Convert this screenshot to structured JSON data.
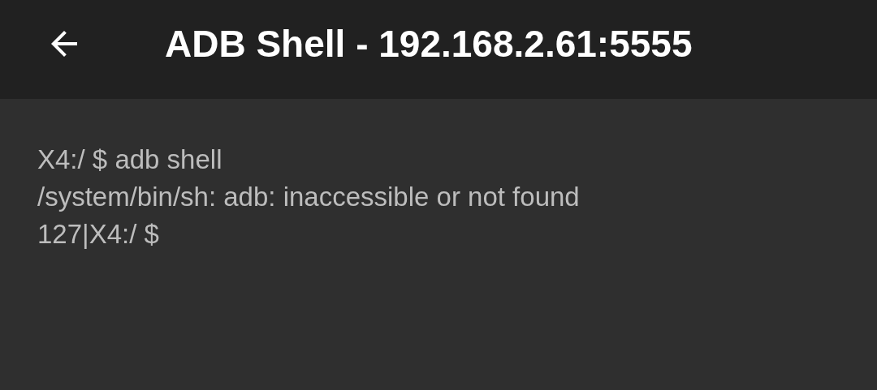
{
  "app_bar": {
    "title": "ADB Shell - 192.168.2.61:5555"
  },
  "terminal": {
    "lines": [
      "X4:/ $ adb shell",
      "/system/bin/sh: adb: inaccessible or not found",
      "127|X4:/ $"
    ]
  }
}
